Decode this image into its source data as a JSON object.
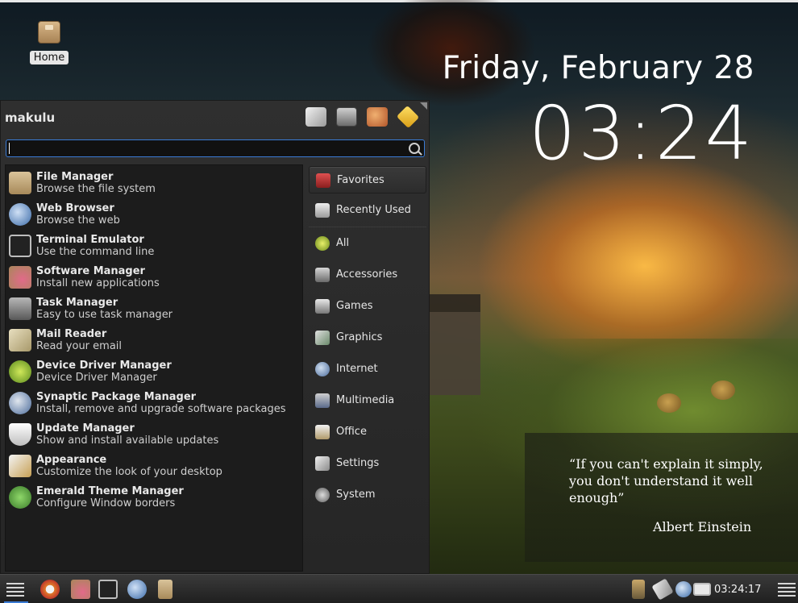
{
  "desktop": {
    "icons": [
      {
        "label": "Home",
        "icon": "home-folder-icon"
      }
    ]
  },
  "clock_widget": {
    "date": "Friday, February 28",
    "time": "03:24"
  },
  "quote_widget": {
    "text": "“If you can't explain it simply, you don't understand it well enough”",
    "author": "Albert Einstein"
  },
  "menu": {
    "username": "makulu",
    "search": {
      "value": "",
      "placeholder": ""
    },
    "toolbar": [
      "settings-icon",
      "screen-icon",
      "users-icon",
      "logout-icon"
    ],
    "apps": [
      {
        "name": "File Manager",
        "desc": "Browse the file system",
        "icon": "file-manager-icon"
      },
      {
        "name": "Web Browser",
        "desc": "Browse the web",
        "icon": "web-browser-icon"
      },
      {
        "name": "Terminal Emulator",
        "desc": "Use the command line",
        "icon": "terminal-icon"
      },
      {
        "name": "Software Manager",
        "desc": "Install new applications",
        "icon": "software-manager-icon"
      },
      {
        "name": "Task Manager",
        "desc": "Easy to use task manager",
        "icon": "task-manager-icon"
      },
      {
        "name": "Mail Reader",
        "desc": "Read your email",
        "icon": "mail-icon"
      },
      {
        "name": "Device Driver Manager",
        "desc": "Device Driver Manager",
        "icon": "driver-manager-icon"
      },
      {
        "name": "Synaptic Package Manager",
        "desc": "Install, remove and upgrade software packages",
        "icon": "synaptic-icon"
      },
      {
        "name": "Update Manager",
        "desc": "Show and install available updates",
        "icon": "update-shield-icon"
      },
      {
        "name": "Appearance",
        "desc": "Customize the look of your desktop",
        "icon": "appearance-icon"
      },
      {
        "name": "Emerald Theme Manager",
        "desc": "Configure Window borders",
        "icon": "emerald-theme-icon"
      }
    ],
    "categories": [
      {
        "label": "Favorites",
        "icon": "favorites-icon",
        "active": true
      },
      {
        "label": "Recently Used",
        "icon": "recently-used-icon"
      },
      {
        "label": "All",
        "icon": "all-apps-icon"
      },
      {
        "label": "Accessories",
        "icon": "accessories-icon"
      },
      {
        "label": "Games",
        "icon": "games-icon"
      },
      {
        "label": "Graphics",
        "icon": "graphics-icon"
      },
      {
        "label": "Internet",
        "icon": "internet-icon"
      },
      {
        "label": "Multimedia",
        "icon": "multimedia-icon"
      },
      {
        "label": "Office",
        "icon": "office-icon"
      },
      {
        "label": "Settings",
        "icon": "settings-cat-icon"
      },
      {
        "label": "System",
        "icon": "system-icon"
      }
    ]
  },
  "taskbar": {
    "launchers": [
      "sync-icon",
      "software-manager-icon",
      "terminal-icon",
      "web-browser-icon",
      "file-manager-icon"
    ],
    "tray": [
      "usb-icon",
      "pen-icon",
      "globe-icon",
      "display-icon"
    ],
    "clock": "03:24:17"
  },
  "colors": {
    "accent": "#3a7bd5",
    "menu_bg": "#2c2c2c",
    "list_bg": "#1c1c1c"
  }
}
